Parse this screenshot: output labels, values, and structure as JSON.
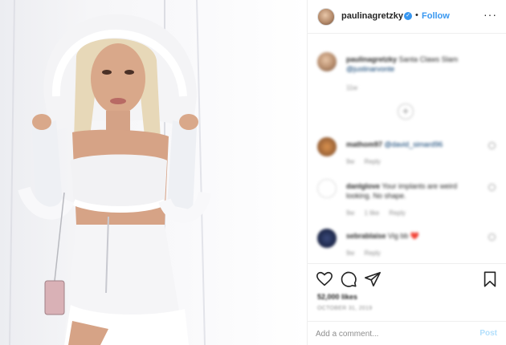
{
  "post": {
    "username": "paulinagretzky",
    "follow_label": "Follow",
    "separator": "•",
    "more_label": "···",
    "verified_glyph": "✓"
  },
  "comments": [
    {
      "username": "paulinagretzky",
      "text": "Santa Claws Slam",
      "mention": "@justinarvonte",
      "meta": [
        "11w"
      ]
    },
    {
      "username": "mathom97",
      "text": "",
      "mention": "@david_simard96",
      "meta": [
        "9w",
        "Reply"
      ]
    },
    {
      "username": "danlglove",
      "text": "Your implants are weird looking. No shape.",
      "mention": "",
      "meta": [
        "9w",
        "1 like",
        "Reply"
      ]
    },
    {
      "username": "sebrablaise",
      "text": "Vig bb ❤️",
      "mention": "",
      "meta": [
        "9w",
        "Reply"
      ]
    }
  ],
  "load_more_glyph": "+",
  "footer": {
    "likes": "52,000 likes",
    "date": "OCTOBER 31, 2019",
    "comment_placeholder": "Add a comment...",
    "post_label": "Post"
  },
  "icons": {
    "like": "heart-icon",
    "comment": "comment-icon",
    "share": "paper-plane-icon",
    "save": "bookmark-icon",
    "verified": "verified-badge-icon"
  },
  "colors": {
    "accent": "#3897f0",
    "text": "#262626",
    "muted": "#8e8e8e",
    "border": "#efefef"
  }
}
